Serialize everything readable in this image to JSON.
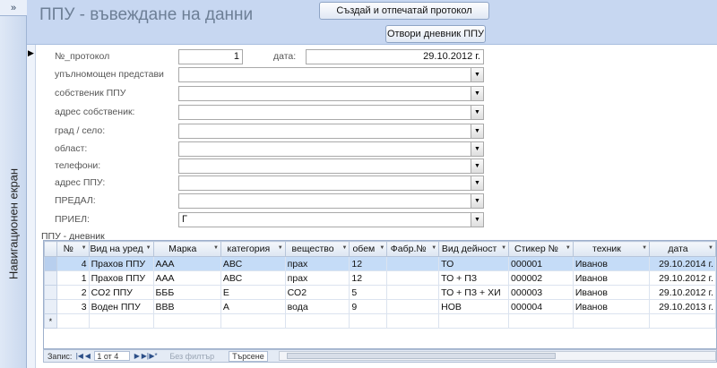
{
  "nav_pane": {
    "label": "Навигационен екран",
    "toggle_glyph": "»"
  },
  "header": {
    "title": "ППУ - въвеждане на данни",
    "create_print_button": "Създай и отпечатай протокол",
    "open_journal_button": "Отвори дневник ППУ"
  },
  "record_selector_glyph": "▶",
  "fields": {
    "protocol_no": {
      "label": "№_протокол",
      "value": "1"
    },
    "date": {
      "label": "дата:",
      "value": "29.10.2012 г."
    },
    "representative": {
      "label": "упълномощен представи"
    },
    "owner": {
      "label": "собственик ППУ"
    },
    "owner_address": {
      "label": "адрес собственик:"
    },
    "city": {
      "label": "град / село:"
    },
    "region": {
      "label": "област:"
    },
    "phones": {
      "label": "телефони:"
    },
    "ppu_address": {
      "label": "адрес ППУ:"
    },
    "handed_over": {
      "label": "ПРЕДАЛ:"
    },
    "received": {
      "label": "ПРИЕЛ:",
      "value": "Г"
    }
  },
  "dropdown_glyph": "▼",
  "subform": {
    "label": "ППУ - дневник",
    "columns": [
      "№",
      "Вид на уред",
      "Марка",
      "категория",
      "вещество",
      "обем",
      "Фабр.№",
      "Вид дейност",
      "Стикер №",
      "техник",
      "дата"
    ],
    "rows": [
      [
        "4",
        "Прахов ППУ",
        "ААА",
        "АВС",
        "прах",
        "12",
        "",
        "ТО",
        "000001",
        "Иванов",
        "29.10.2014 г."
      ],
      [
        "1",
        "Прахов ППУ",
        "ААА",
        "АВС",
        "прах",
        "12",
        "",
        "ТО + ПЗ",
        "000002",
        "Иванов",
        "29.10.2012 г."
      ],
      [
        "2",
        "CO2 ППУ",
        "БББ",
        "Е",
        "СО2",
        "5",
        "",
        "ТО + ПЗ + ХИ",
        "000003",
        "Иванов",
        "29.10.2012 г."
      ],
      [
        "3",
        "Воден ППУ",
        "ВВВ",
        "А",
        "вода",
        "9",
        "",
        "НОВ",
        "000004",
        "Иванов",
        "29.10.2013 г."
      ]
    ],
    "new_row_glyph": "*"
  },
  "record_nav": {
    "label": "Запис:",
    "position": "1 от 4",
    "filter": "Без филтър",
    "search": "Търсене"
  }
}
